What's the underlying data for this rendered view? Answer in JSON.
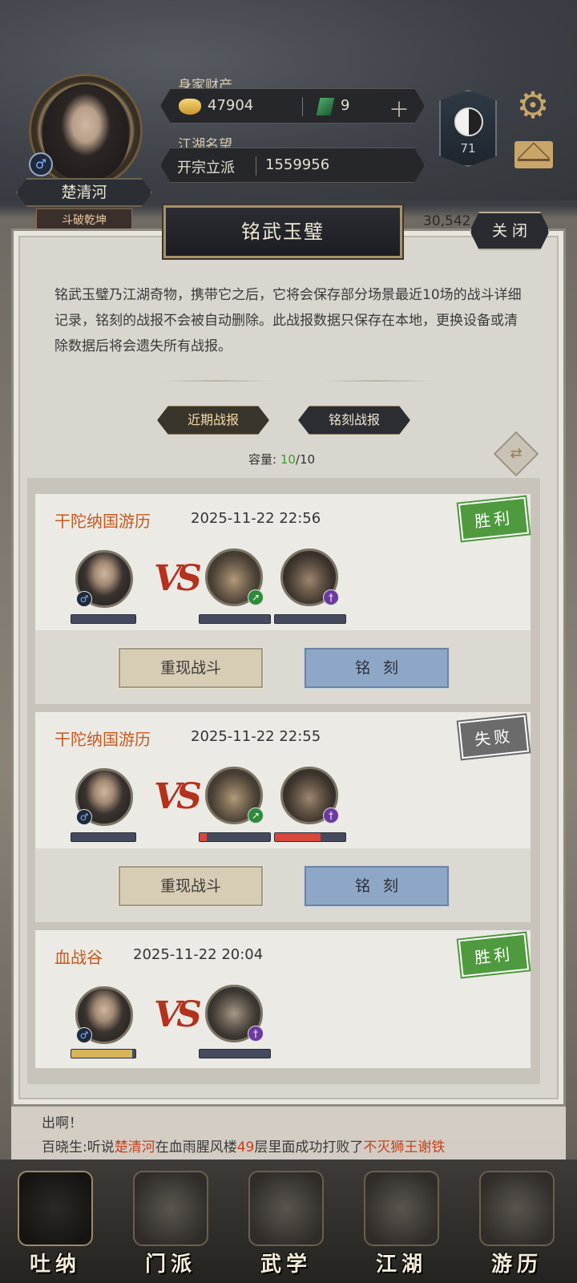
{
  "header": {
    "player_name": "楚清河",
    "player_title": "斗破乾坤",
    "wealth_label": "身家财产",
    "gold": "47904",
    "jade": "9",
    "fame_label": "江湖名望",
    "fame_rank": "开宗立派",
    "fame_value": "1559956",
    "yinyang_level": "71",
    "bg_number": "30,542"
  },
  "panel": {
    "title": "铭武玉璧",
    "close_label": "关 闭",
    "description": "铭武玉璧乃江湖奇物，携带它之后，它将会保存部分场景最近10场的战斗详细记录，铭刻的战报不会被自动删除。此战报数据只保存在本地，更换设备或清除数据后将会遗失所有战报。",
    "tab_recent": "近期战报",
    "tab_engraved": "铭刻战报",
    "capacity_label": "容量: ",
    "capacity_used": "10",
    "capacity_total": "/10"
  },
  "records": [
    {
      "title": "干陀纳国游历",
      "time": "2025-11-22 22:56",
      "result": "胜利",
      "replay_label": "重现战斗",
      "engrave_label": "铭刻",
      "player_hp": 0,
      "enemy_hp": [
        0,
        0
      ]
    },
    {
      "title": "干陀纳国游历",
      "time": "2025-11-22 22:55",
      "result": "失败",
      "replay_label": "重现战斗",
      "engrave_label": "铭刻",
      "player_hp": 0,
      "enemy_hp": [
        0.1,
        0.65
      ]
    },
    {
      "title": "血战谷",
      "time": "2025-11-22 20:04",
      "result": "胜利",
      "player_hp": 0.95,
      "enemy_hp": [
        0
      ]
    }
  ],
  "vs_text": "VS",
  "chat": {
    "line1": "出啊！",
    "line2_prefix": "百晓生:听说",
    "line2_name": "楚清河",
    "line2_mid": "在血雨腥风楼",
    "line2_floor": "49",
    "line2_mid2": "层里面成功打败了",
    "line2_boss": "不灭狮王谢铁"
  },
  "nav": [
    {
      "label": "吐纳",
      "icon": "meditation-icon"
    },
    {
      "label": "门派",
      "icon": "sect-icon"
    },
    {
      "label": "武学",
      "icon": "martial-arts-book-icon"
    },
    {
      "label": "江湖",
      "icon": "jianghu-hat-icon"
    },
    {
      "label": "游历",
      "icon": "travel-horse-icon"
    }
  ],
  "colors": {
    "win": "#4f9a3e",
    "lose": "#6b6b6b",
    "record_title": "#c8581e",
    "hp_red": "#d9473a",
    "hp_gold": "#d6b45a"
  }
}
